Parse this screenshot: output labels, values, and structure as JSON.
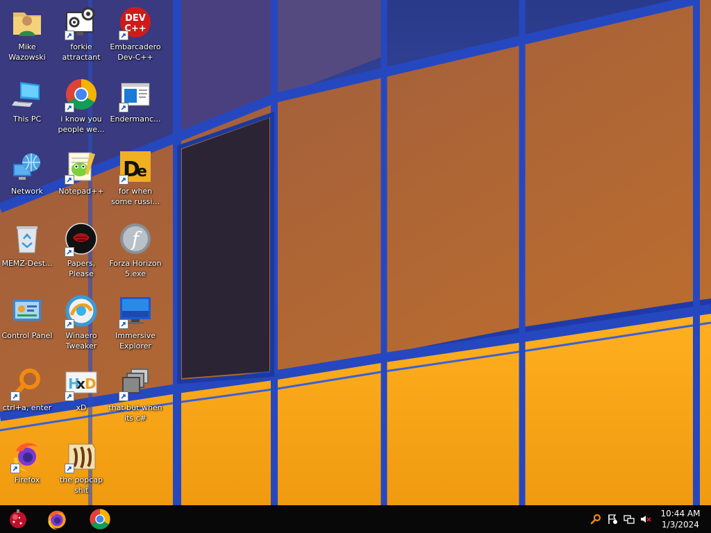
{
  "desktop": {
    "icons": [
      {
        "label": "Mike\nWazowski",
        "icon": "user-folder-icon"
      },
      {
        "label": "forkie\nattractant",
        "icon": "gears-monitor-icon"
      },
      {
        "label": "Embarcadero\nDev-C++",
        "icon": "devcpp-icon"
      },
      {
        "label": "This PC",
        "icon": "computer-icon"
      },
      {
        "label": "i know you\npeople we...",
        "icon": "chrome-icon"
      },
      {
        "label": "Endermanc...",
        "icon": "window-app-icon"
      },
      {
        "label": "Network",
        "icon": "network-globe-icon"
      },
      {
        "label": "Notepad++",
        "icon": "notepadpp-icon"
      },
      {
        "label": "for when\nsome russi...",
        "icon": "de-app-icon"
      },
      {
        "label": "MEMZ-Dest...",
        "icon": "recycle-bin-icon"
      },
      {
        "label": "Papers, Please",
        "icon": "papers-please-icon"
      },
      {
        "label": "Forza Horizon\n5.exe",
        "icon": "flash-icon"
      },
      {
        "label": "Control Panel",
        "icon": "control-panel-icon"
      },
      {
        "label": "Winaero\nTweaker",
        "icon": "winaero-icon"
      },
      {
        "label": "Immersive\nExplorer",
        "icon": "monitor-app-icon"
      },
      {
        "label": "ctrl+a, enter",
        "icon": "magnifier-icon"
      },
      {
        "label": "xD",
        "icon": "hxd-icon"
      },
      {
        "label": "that but when\nits c#",
        "icon": "stacked-windows-icon"
      },
      {
        "label": "Firefox",
        "icon": "firefox-icon"
      },
      {
        "label": "the popcap\nshit",
        "icon": "popcap-icon"
      }
    ]
  },
  "taskbar": {
    "start_icon": "start-orb-icon",
    "pinned": [
      {
        "name": "Firefox",
        "icon": "firefox-icon"
      },
      {
        "name": "Google Chrome",
        "icon": "chrome-icon"
      }
    ],
    "tray": {
      "icons": [
        "search-tray-icon",
        "flag-icon",
        "network-tray-icon",
        "volume-muted-icon"
      ]
    },
    "clock": {
      "time": "10:44 AM",
      "date": "1/3/2024"
    }
  },
  "colors": {
    "taskbar": "#080808",
    "frame_blue": "#2a4fc8",
    "glass_orange": "#f5a516",
    "glass_dark": "#3a2a40"
  }
}
